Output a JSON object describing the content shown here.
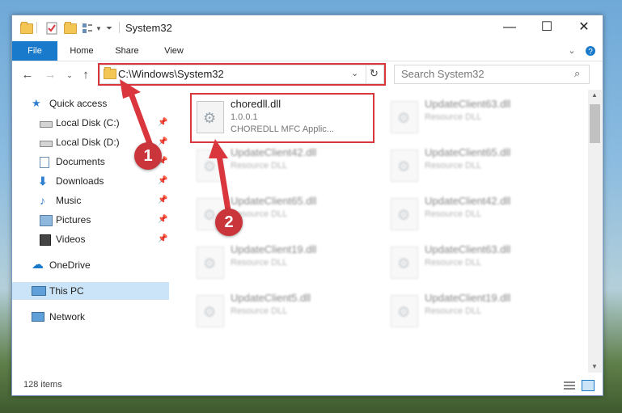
{
  "window": {
    "title": "System32"
  },
  "ribbon": {
    "tabs": [
      {
        "label": "File"
      },
      {
        "label": "Home"
      },
      {
        "label": "Share"
      },
      {
        "label": "View"
      }
    ]
  },
  "address": {
    "path": "C:\\Windows\\System32"
  },
  "search": {
    "placeholder": "Search System32"
  },
  "sidebar": {
    "items": [
      {
        "label": "Quick access",
        "icon": "star-icon"
      },
      {
        "label": "Local Disk (C:)",
        "icon": "drive-icon",
        "pinned": true
      },
      {
        "label": "Local Disk (D:)",
        "icon": "drive-icon",
        "pinned": true
      },
      {
        "label": "Documents",
        "icon": "documents-icon",
        "pinned": true
      },
      {
        "label": "Downloads",
        "icon": "downloads-icon",
        "pinned": true
      },
      {
        "label": "Music",
        "icon": "music-icon",
        "pinned": true
      },
      {
        "label": "Pictures",
        "icon": "pictures-icon",
        "pinned": true
      },
      {
        "label": "Videos",
        "icon": "videos-icon",
        "pinned": true
      },
      {
        "label": "OneDrive",
        "icon": "cloud-icon"
      },
      {
        "label": "This PC",
        "icon": "computer-icon",
        "selected": true
      },
      {
        "label": "Network",
        "icon": "network-icon"
      }
    ]
  },
  "files": [
    {
      "name": "choredll.dll",
      "version": "1.0.0.1",
      "desc": "CHOREDLL MFC Applic...",
      "highlighted": true
    },
    {
      "name": "UpdateClient63.dll",
      "desc": "Resource DLL"
    },
    {
      "name": "UpdateClient42.dll",
      "desc": "Resource DLL"
    },
    {
      "name": "UpdateClient65.dll",
      "desc": "Resource DLL"
    },
    {
      "name": "UpdateClient65.dll",
      "desc": "Resource DLL"
    },
    {
      "name": "UpdateClient42.dll",
      "desc": "Resource DLL"
    },
    {
      "name": "UpdateClient19.dll",
      "desc": "Resource DLL"
    },
    {
      "name": "UpdateClient63.dll",
      "desc": "Resource DLL"
    },
    {
      "name": "UpdateClient5.dll",
      "desc": "Resource DLL"
    },
    {
      "name": "UpdateClient19.dll",
      "desc": "Resource DLL"
    }
  ],
  "status": {
    "item_count": "128 items"
  },
  "annotations": {
    "step1": "1",
    "step2": "2"
  },
  "colors": {
    "accent": "#1979ca",
    "highlight_box": "#d9363e",
    "badge": "#c9353a"
  }
}
